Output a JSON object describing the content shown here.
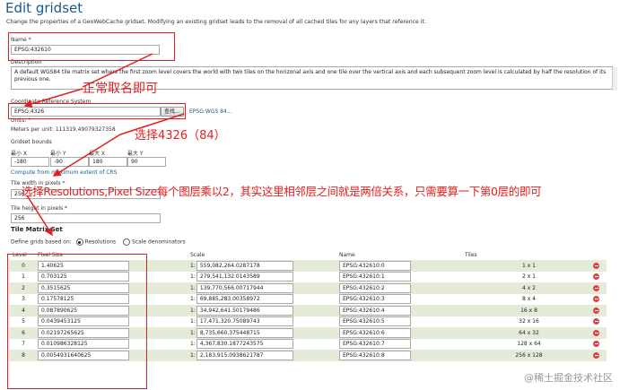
{
  "page": {
    "title": "Edit gridset",
    "description": "Change the properties of a GeoWebCache gridset. Modifying an existing gridset leads to the removal of all cached tiles for any layers that reference it."
  },
  "form": {
    "name_label": "Name *",
    "name_value": "EPSG:432610",
    "description_label": "Description",
    "description_value": "A default WGS84 tile matrix set where the first zoom level covers the world with two tiles on the horizonal axis and one tile over the vertical axis and each subsequent zoom level is calculated by half the resolution of its previous one.",
    "crs_label": "Coordinate Reference System",
    "crs_value": "EPSG:4326",
    "find_button": "查找...",
    "crs_link": "EPSG:WGS 84...",
    "units_label": "Units: °",
    "meters_per_unit": "Meters per unit: 111319.49079327358",
    "bounds_label": "Gridset bounds",
    "bounds": {
      "minx_label": "最小 X",
      "miny_label": "最小 Y",
      "maxx_label": "最大 X",
      "maxy_label": "最大 Y",
      "minx": "-180",
      "miny": "-90",
      "maxx": "180",
      "maxy": "90"
    },
    "compute_link": "Compute from maximum extent of CRS",
    "tile_width_label": "Tile width in pixels *",
    "tile_width": "256",
    "tile_height_label": "Tile height in pixels *",
    "tile_height": "256",
    "matrix_section": "Tile Matrix Set",
    "define_label": "Define grids based on:",
    "radio_resolutions": "Resolutions",
    "radio_scale": "Scale denominators"
  },
  "table": {
    "headers": {
      "level": "Level",
      "pixel": "Pixel Size",
      "scale": "Scale",
      "name": "Name",
      "tiles": "Tiles"
    },
    "rows": [
      {
        "level": "0",
        "pixel": "1.40625",
        "scale": "559,082,264.0287178",
        "name": "EPSG:432610:0",
        "tiles": "1 x 1"
      },
      {
        "level": "1",
        "pixel": "0.703125",
        "scale": "279,541,132.0143589",
        "name": "EPSG:432610:1",
        "tiles": "2 x 1"
      },
      {
        "level": "2",
        "pixel": "0.3515625",
        "scale": "139,770,566.00717944",
        "name": "EPSG:432610:2",
        "tiles": "4 x 2"
      },
      {
        "level": "3",
        "pixel": "0.17578125",
        "scale": "69,885,283.00358972",
        "name": "EPSG:432610:3",
        "tiles": "8 x 4"
      },
      {
        "level": "4",
        "pixel": "0.087890625",
        "scale": "34,942,641.50179486",
        "name": "EPSG:432610:4",
        "tiles": "16 x 8"
      },
      {
        "level": "5",
        "pixel": "0.0439453125",
        "scale": "17,471,320.75089743",
        "name": "EPSG:432610:5",
        "tiles": "32 x 16"
      },
      {
        "level": "6",
        "pixel": "0.02197265625",
        "scale": "8,735,660.375448715",
        "name": "EPSG:432610:6",
        "tiles": "64 x 32"
      },
      {
        "level": "7",
        "pixel": "0.010986328125",
        "scale": "4,367,830.1877243575",
        "name": "EPSG:432610:7",
        "tiles": "128 x 64"
      },
      {
        "level": "8",
        "pixel": "0.0054931640625",
        "scale": "2,183,915.0938621787",
        "name": "EPSG:432610:8",
        "tiles": "256 x 128"
      }
    ]
  },
  "annotations": {
    "name_note": "正常取名即可",
    "crs_note": "选择4326（84）",
    "resolution_note": "选择Resolutions,Pixel Size每个图层乘以2，其实这里相邻层之间就是两倍关系，只需要算一下第0层的即可",
    "color": "#e41e1e"
  },
  "watermark": "@稀土掘金技术社区"
}
